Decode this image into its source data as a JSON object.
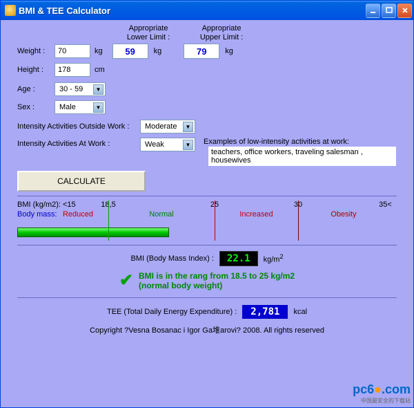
{
  "window": {
    "title": "BMI & TEE Calculator"
  },
  "limits": {
    "lower_label": "Appropriate Lower Limit :",
    "upper_label": "Appropriate Upper Limit :",
    "lower": "59",
    "upper": "79",
    "unit": "kg"
  },
  "inputs": {
    "weight_label": "Weight :",
    "weight": "70",
    "weight_unit": "kg",
    "height_label": "Height :",
    "height": "178",
    "height_unit": "cm",
    "age_label": "Age :",
    "age": "30 - 59",
    "sex_label": "Sex :",
    "sex": "Male",
    "iaow_label": "Intensity Activities Outside Work :",
    "iaow": "Moderate",
    "iaw_label": "Intensity Activities At Work :",
    "iaw": "Weak"
  },
  "examples": {
    "label": "Examples of low-intensity activities at work:",
    "text": "teachers, office workers, traveling salesman , housewives"
  },
  "calculate": "CALCULATE",
  "scale": {
    "header": "BMI (kg/m2): <15",
    "body_mass": "Body mass:",
    "t185": "18,5",
    "t25": "25",
    "t30": "30",
    "t35": "35<",
    "reduced": "Reduced",
    "normal": "Normal",
    "increased": "Increased",
    "obesity": "Obesity"
  },
  "result": {
    "bmi_label": "BMI (Body Mass Index) :",
    "bmi_value": "22.1",
    "bmi_unit": "kg/m",
    "bmi_exp": "2",
    "msg1": "BMI is in the rang from 18.5 to 25 kg/m2",
    "msg2": "(normal body weight)"
  },
  "tee": {
    "label": "TEE (Total Daily Energy Expenditure) :",
    "value": "2,781",
    "unit": "kcal"
  },
  "copyright": "Copyright ?Vesna Bosanac i Igor Ga堆arovi? 2008. All rights reserved",
  "watermark": {
    "text": "pc6",
    "suffix": ".com",
    "sub": "中国最安全的下载站"
  }
}
